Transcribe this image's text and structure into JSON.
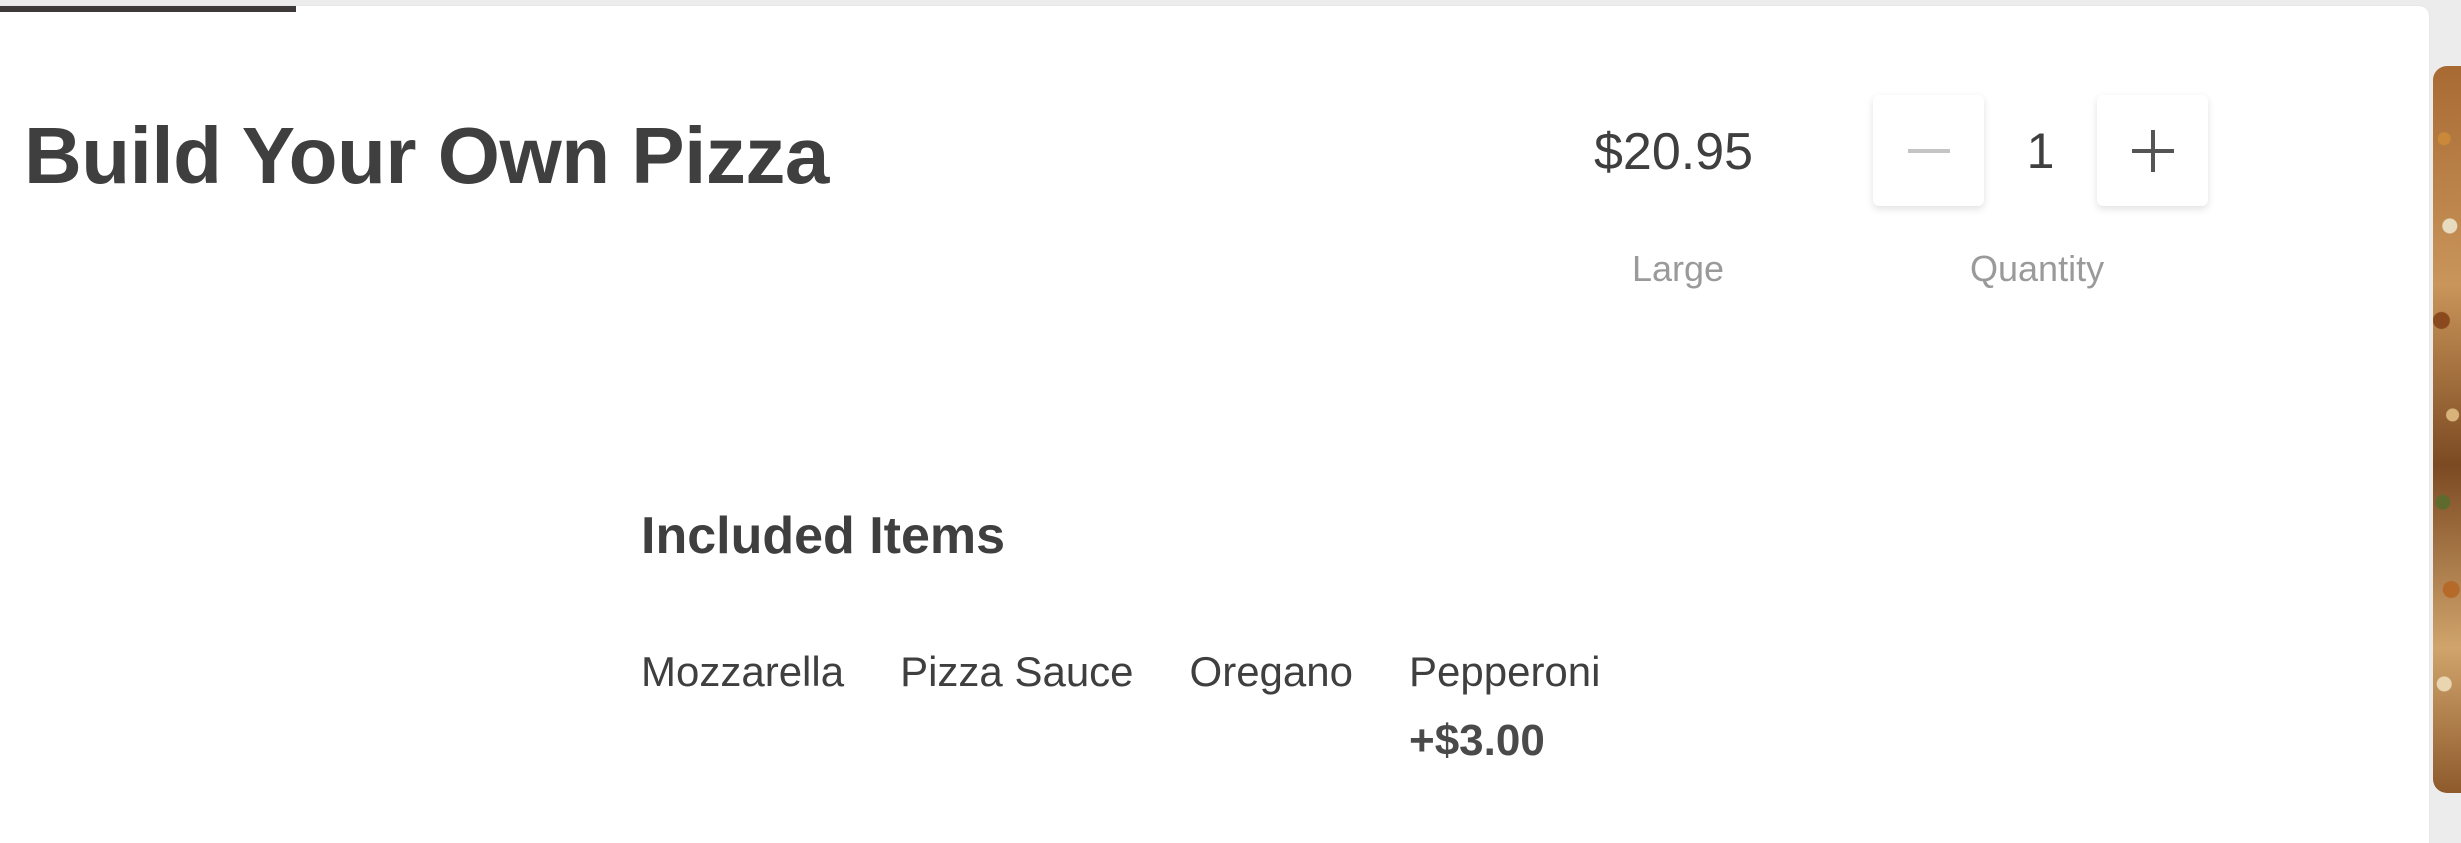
{
  "product": {
    "title": "Build Your Own Pizza",
    "price": "$20.95",
    "size_label": "Large"
  },
  "quantity": {
    "value": "1",
    "label": "Quantity",
    "decrement_icon": "minus-icon",
    "increment_icon": "plus-icon"
  },
  "included": {
    "title": "Included Items",
    "items": [
      {
        "name": "Mozzarella",
        "price": ""
      },
      {
        "name": "Pizza Sauce",
        "price": ""
      },
      {
        "name": "Oregano",
        "price": ""
      },
      {
        "name": "Pepperoni",
        "price": "+$3.00"
      }
    ]
  },
  "colors": {
    "text": "#3f3f3f",
    "muted": "#9a9a9a",
    "progress": "#3f3a3a",
    "disabled_icon": "#c4c4c4"
  }
}
